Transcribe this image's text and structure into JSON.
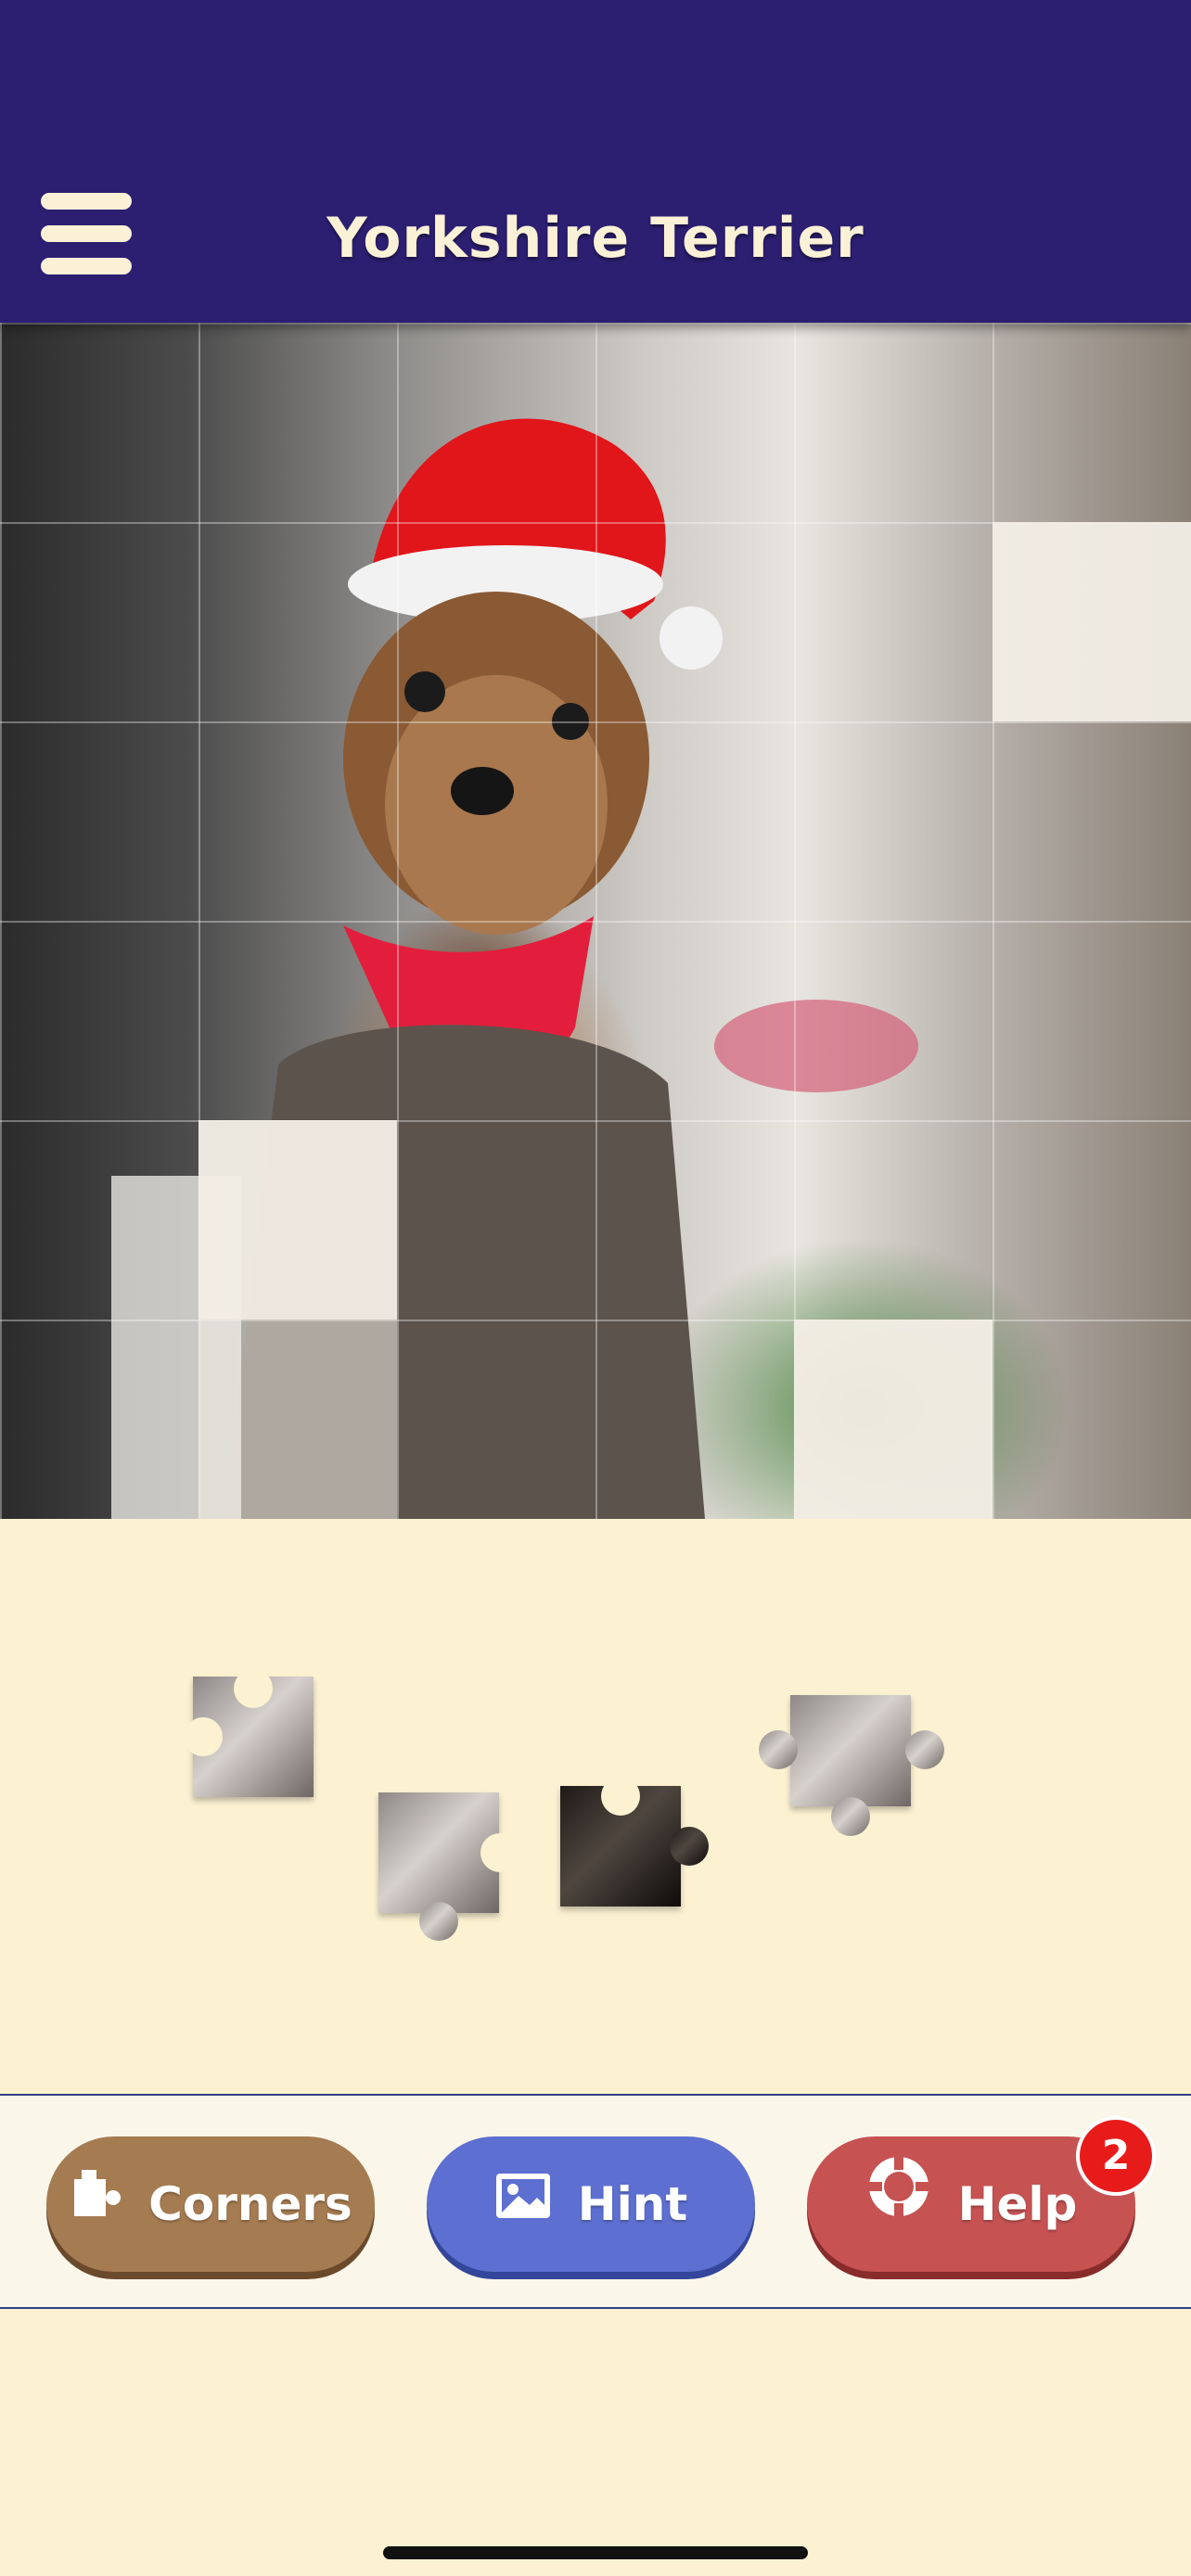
{
  "header": {
    "title": "Yorkshire Terrier",
    "menu_icon": "hamburger-menu-icon",
    "background": "#2c1f72"
  },
  "toolbar": {
    "corners_label": "Corners",
    "hint_label": "Hint",
    "help_label": "Help",
    "help_badge": "2",
    "corners_color": "#a57b51",
    "hint_color": "#5d6fd1",
    "help_color": "#c65252"
  },
  "puzzle": {
    "image_subject": "dog-in-santa-hat",
    "loose_pieces_count": 4
  }
}
